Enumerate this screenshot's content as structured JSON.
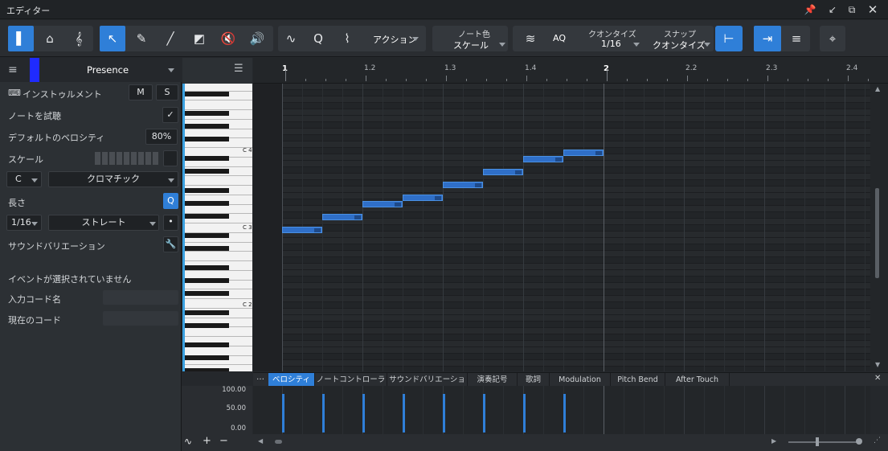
{
  "window": {
    "title": "エディター"
  },
  "toolbar": {
    "action_label": "アクション",
    "note_color_label": "ノート色",
    "note_color_value": "スケール",
    "aq_label": "AQ",
    "quantize_label": "クオンタイズ",
    "quantize_value": "1/16",
    "snap_label": "スナップ",
    "snap_value": "クオンタイズ"
  },
  "inspector": {
    "track_name": "Presence",
    "track_color": "#1f2bff",
    "instrument_label": "インストゥルメント",
    "mute_label": "M",
    "solo_label": "S",
    "audition_label": "ノートを試聴",
    "default_velocity_label": "デフォルトのベロシティ",
    "default_velocity_value": "80%",
    "scale_label": "スケール",
    "scale_root": "C",
    "scale_type": "クロマチック",
    "length_label": "長さ",
    "length_value": "1/16",
    "length_mode": "ストレート",
    "sound_variation_label": "サウンドバリエーション",
    "no_event_label": "イベントが選択されていません",
    "input_chord_label": "入力コード名",
    "current_chord_label": "現在のコード"
  },
  "piano": {
    "labels": [
      "C 4",
      "C 3",
      "C 2"
    ]
  },
  "ruler": {
    "labels": [
      "1",
      "1.2",
      "1.3",
      "1.4",
      "2",
      "2.2",
      "2.3",
      "2.4"
    ]
  },
  "lanes": {
    "tabs": [
      "ベロシティ",
      "ノートコントローラー",
      "サウンドバリエーション",
      "演奏記号",
      "歌詞",
      "Modulation",
      "Pitch Bend",
      "After Touch"
    ],
    "velocity_scale": [
      "100.00",
      "50.00",
      "0.00"
    ]
  },
  "notes": [
    {
      "pitch": "C3",
      "start": 1.0,
      "length": "1/16"
    },
    {
      "pitch": "D3",
      "start": 1.05,
      "length": "1/16"
    },
    {
      "pitch": "E3",
      "start": 1.1,
      "length": "1/16"
    },
    {
      "pitch": "F3",
      "start": 1.15,
      "length": "1/16"
    },
    {
      "pitch": "G3",
      "start": 1.2,
      "length": "1/16"
    },
    {
      "pitch": "A3",
      "start": 1.25,
      "length": "1/16"
    },
    {
      "pitch": "B3",
      "start": 1.3,
      "length": "1/16"
    },
    {
      "pitch": "C4",
      "start": 1.35,
      "length": "1/16"
    }
  ],
  "accent_color": "#2f7fd8"
}
